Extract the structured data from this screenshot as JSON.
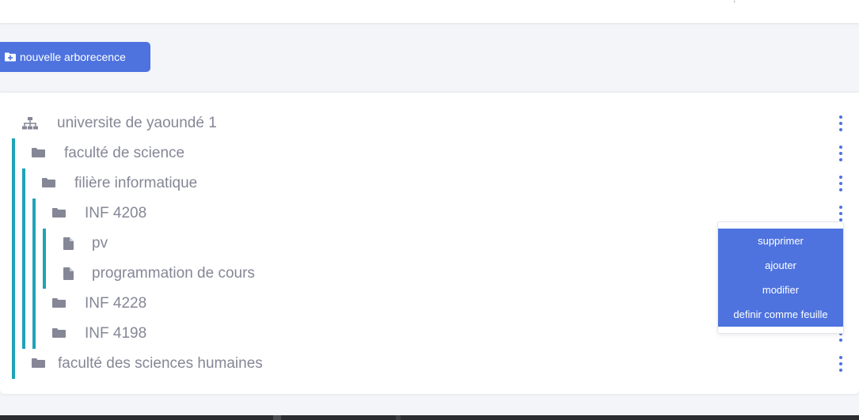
{
  "toolbar": {
    "new_tree_label": "nouvelle arborecence",
    "new_tree_icon": "folder-plus-icon"
  },
  "tree": {
    "nodes": [
      {
        "label": "universite de yaoundé 1",
        "icon": "sitemap-icon",
        "level": 0
      },
      {
        "label": "faculté de science",
        "icon": "folder-icon",
        "level": 1
      },
      {
        "label": "filière informatique",
        "icon": "folder-icon",
        "level": 2
      },
      {
        "label": "INF 4208",
        "icon": "folder-icon",
        "level": 3
      },
      {
        "label": "pv",
        "icon": "file-icon",
        "level": 4
      },
      {
        "label": "programmation de cours",
        "icon": "file-icon",
        "level": 4
      },
      {
        "label": "INF 4228",
        "icon": "folder-icon",
        "level": 3
      },
      {
        "label": "INF 4198",
        "icon": "folder-icon",
        "level": 3
      },
      {
        "label": "faculté des sciences humaines",
        "icon": "folder-icon",
        "level": 1
      }
    ]
  },
  "context_menu": {
    "items": [
      "supprimer",
      "ajouter",
      "modifier",
      "definir comme feuille"
    ]
  },
  "colors": {
    "accent": "#4e73df",
    "tree_guide": "#1ea3b7",
    "text": "#858796",
    "icon": "#858796"
  }
}
